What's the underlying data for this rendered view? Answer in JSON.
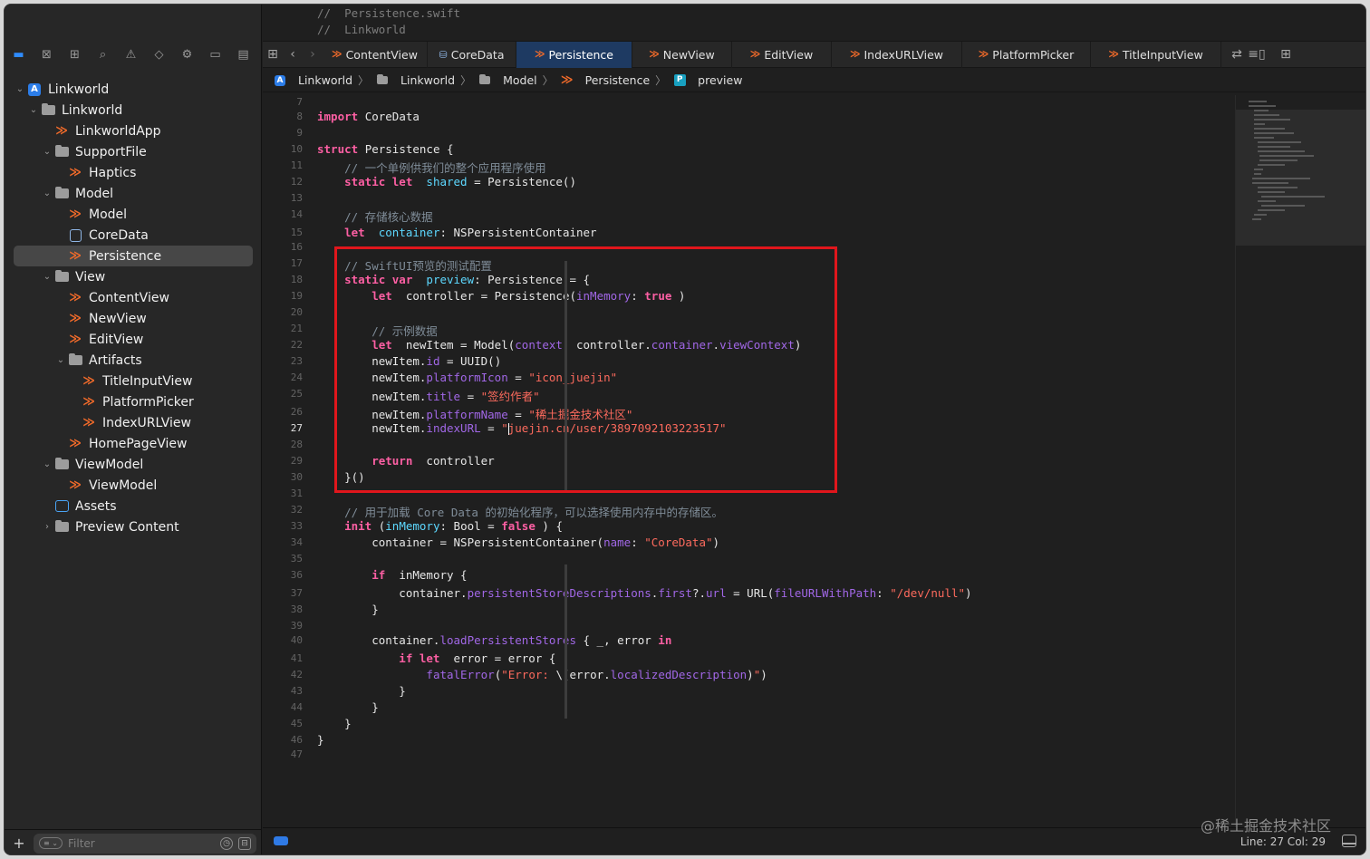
{
  "header_comment": [
    "//  Persistence.swift",
    "//  Linkworld"
  ],
  "navigator_icons": [
    "folder-icon",
    "source-control-icon",
    "symbols-icon",
    "find-icon",
    "issues-icon",
    "tests-icon",
    "debug-icon",
    "breakpoints-icon",
    "reports-icon"
  ],
  "tree": [
    {
      "label": "Linkworld",
      "depth": 0,
      "icon": "project",
      "disclosure": "open"
    },
    {
      "label": "Linkworld",
      "depth": 1,
      "icon": "folder",
      "disclosure": "open"
    },
    {
      "label": "LinkworldApp",
      "depth": 2,
      "icon": "swift",
      "disclosure": ""
    },
    {
      "label": "SupportFile",
      "depth": 2,
      "icon": "folder",
      "disclosure": "open"
    },
    {
      "label": "Haptics",
      "depth": 3,
      "icon": "swift",
      "disclosure": ""
    },
    {
      "label": "Model",
      "depth": 2,
      "icon": "folder",
      "disclosure": "open"
    },
    {
      "label": "Model",
      "depth": 3,
      "icon": "swift",
      "disclosure": ""
    },
    {
      "label": "CoreData",
      "depth": 3,
      "icon": "coredata",
      "disclosure": ""
    },
    {
      "label": "Persistence",
      "depth": 3,
      "icon": "swift",
      "disclosure": "",
      "selected": true
    },
    {
      "label": "View",
      "depth": 2,
      "icon": "folder",
      "disclosure": "open"
    },
    {
      "label": "ContentView",
      "depth": 3,
      "icon": "swift",
      "disclosure": ""
    },
    {
      "label": "NewView",
      "depth": 3,
      "icon": "swift",
      "disclosure": ""
    },
    {
      "label": "EditView",
      "depth": 3,
      "icon": "swift",
      "disclosure": ""
    },
    {
      "label": "Artifacts",
      "depth": 3,
      "icon": "folder",
      "disclosure": "open"
    },
    {
      "label": "TitleInputView",
      "depth": 4,
      "icon": "swift",
      "disclosure": ""
    },
    {
      "label": "PlatformPicker",
      "depth": 4,
      "icon": "swift",
      "disclosure": ""
    },
    {
      "label": "IndexURLView",
      "depth": 4,
      "icon": "swift",
      "disclosure": ""
    },
    {
      "label": "HomePageView",
      "depth": 3,
      "icon": "swift",
      "disclosure": ""
    },
    {
      "label": "ViewModel",
      "depth": 2,
      "icon": "folder",
      "disclosure": "open"
    },
    {
      "label": "ViewModel",
      "depth": 3,
      "icon": "swift",
      "disclosure": ""
    },
    {
      "label": "Assets",
      "depth": 2,
      "icon": "assets",
      "disclosure": ""
    },
    {
      "label": "Preview Content",
      "depth": 2,
      "icon": "folder",
      "disclosure": "closed"
    }
  ],
  "filter": {
    "placeholder": "Filter",
    "add_label": "+"
  },
  "tabs": [
    {
      "label": "ContentView",
      "icon": "swift",
      "active": false
    },
    {
      "label": "CoreData",
      "icon": "coredata",
      "active": false
    },
    {
      "label": "Persistence",
      "icon": "swift",
      "active": true
    },
    {
      "label": "NewView",
      "icon": "swift",
      "active": false
    },
    {
      "label": "EditView",
      "icon": "swift",
      "active": false
    },
    {
      "label": "IndexURLView",
      "icon": "swift",
      "active": false
    },
    {
      "label": "PlatformPicker",
      "icon": "swift",
      "active": false
    },
    {
      "label": "TitleInputView",
      "icon": "swift",
      "active": false
    }
  ],
  "breadcrumb": [
    {
      "label": "Linkworld",
      "icon": "project"
    },
    {
      "label": "Linkworld",
      "icon": "folder"
    },
    {
      "label": "Model",
      "icon": "folder"
    },
    {
      "label": "Persistence",
      "icon": "swift"
    },
    {
      "label": "preview",
      "icon": "property"
    }
  ],
  "code_lines": [
    {
      "n": "7",
      "segs": []
    },
    {
      "n": "8",
      "segs": [
        [
          "k",
          "import"
        ],
        [
          "",
          "CoreData"
        ]
      ]
    },
    {
      "n": "9",
      "segs": []
    },
    {
      "n": "10",
      "segs": [
        [
          "k",
          "struct"
        ],
        [
          "",
          "Persistence {"
        ]
      ]
    },
    {
      "n": "11",
      "segs": [
        [
          "c",
          "    // 一个单例供我们的整个应用程序使用"
        ]
      ]
    },
    {
      "n": "12",
      "segs": [
        [
          "k",
          "    static let"
        ],
        [
          "t",
          "shared"
        ],
        [
          "",
          " = Persistence()"
        ]
      ]
    },
    {
      "n": "13",
      "segs": []
    },
    {
      "n": "14",
      "segs": [
        [
          "c",
          "    // 存储核心数据"
        ]
      ]
    },
    {
      "n": "15",
      "segs": [
        [
          "k",
          "    let"
        ],
        [
          "t",
          "container"
        ],
        [
          "",
          ": NSPersistentContainer"
        ]
      ]
    },
    {
      "n": "16",
      "segs": []
    },
    {
      "n": "17",
      "segs": [
        [
          "c",
          "    // SwiftUI预览的测试配置"
        ]
      ]
    },
    {
      "n": "18",
      "segs": [
        [
          "k",
          "    static var"
        ],
        [
          "t",
          "preview"
        ],
        [
          "",
          ": Persistence = {"
        ]
      ]
    },
    {
      "n": "19",
      "segs": [
        [
          "k",
          "        let"
        ],
        [
          "",
          " controller = Persistence("
        ],
        [
          "p",
          "inMemory"
        ],
        [
          "",
          ": "
        ],
        [
          "k",
          "true"
        ],
        [
          "",
          ")"
        ]
      ]
    },
    {
      "n": "20",
      "segs": []
    },
    {
      "n": "21",
      "segs": [
        [
          "c",
          "        // 示例数据"
        ]
      ]
    },
    {
      "n": "22",
      "segs": [
        [
          "k",
          "        let"
        ],
        [
          "",
          " newItem = Model("
        ],
        [
          "p",
          "context"
        ],
        [
          "",
          ": controller."
        ],
        [
          "p",
          "container"
        ],
        [
          "",
          "."
        ],
        [
          "p",
          "viewContext"
        ],
        [
          "",
          ")"
        ]
      ]
    },
    {
      "n": "23",
      "segs": [
        [
          "",
          "        newItem."
        ],
        [
          "p",
          "id"
        ],
        [
          "",
          " = UUID()"
        ]
      ]
    },
    {
      "n": "24",
      "segs": [
        [
          "",
          "        newItem."
        ],
        [
          "p",
          "platformIcon"
        ],
        [
          "",
          " = "
        ],
        [
          "s",
          "\"icon_juejin\""
        ]
      ]
    },
    {
      "n": "25",
      "segs": [
        [
          "",
          "        newItem."
        ],
        [
          "p",
          "title"
        ],
        [
          "",
          " = "
        ],
        [
          "s",
          "\"签约作者\""
        ]
      ]
    },
    {
      "n": "26",
      "segs": [
        [
          "",
          "        newItem."
        ],
        [
          "p",
          "platformName"
        ],
        [
          "",
          " = "
        ],
        [
          "s",
          "\"稀土掘金技术社区\""
        ]
      ]
    },
    {
      "n": "27",
      "segs": [
        [
          "",
          "        newItem."
        ],
        [
          "p",
          "indexURL"
        ],
        [
          "",
          " = "
        ],
        [
          "s",
          "\""
        ],
        [
          "cursor",
          ""
        ],
        [
          "s",
          "juejin.cn/user/3897092103223517\""
        ]
      ]
    },
    {
      "n": "28",
      "segs": []
    },
    {
      "n": "29",
      "segs": [
        [
          "k",
          "        return"
        ],
        [
          "",
          " controller"
        ]
      ]
    },
    {
      "n": "30",
      "segs": [
        [
          "",
          "    }()"
        ]
      ]
    },
    {
      "n": "31",
      "segs": []
    },
    {
      "n": "32",
      "segs": [
        [
          "c",
          "    // 用于加载 Core Data 的初始化程序，可以选择使用内存中的存储区。"
        ]
      ]
    },
    {
      "n": "33",
      "segs": [
        [
          "k",
          "    init"
        ],
        [
          "",
          "("
        ],
        [
          "t",
          "inMemory"
        ],
        [
          "",
          ": Bool = "
        ],
        [
          "k",
          "false"
        ],
        [
          "",
          ") {"
        ]
      ]
    },
    {
      "n": "34",
      "segs": [
        [
          "",
          "        container = NSPersistentContainer("
        ],
        [
          "p",
          "name"
        ],
        [
          "",
          ": "
        ],
        [
          "s",
          "\"CoreData\""
        ],
        [
          "",
          ")"
        ]
      ]
    },
    {
      "n": "35",
      "segs": []
    },
    {
      "n": "36",
      "segs": [
        [
          "k",
          "        if"
        ],
        [
          "",
          " inMemory {"
        ]
      ]
    },
    {
      "n": "37",
      "segs": [
        [
          "",
          "            container."
        ],
        [
          "p",
          "persistentStoreDescriptions"
        ],
        [
          "",
          "."
        ],
        [
          "p",
          "first"
        ],
        [
          "",
          "?."
        ],
        [
          "p",
          "url"
        ],
        [
          "",
          " = URL("
        ],
        [
          "p",
          "fileURLWithPath"
        ],
        [
          "",
          ": "
        ],
        [
          "s",
          "\"/dev/null\""
        ],
        [
          "",
          ")"
        ]
      ]
    },
    {
      "n": "38",
      "segs": [
        [
          "",
          "        }"
        ]
      ]
    },
    {
      "n": "39",
      "segs": []
    },
    {
      "n": "40",
      "segs": [
        [
          "",
          "        container."
        ],
        [
          "p",
          "loadPersistentStores"
        ],
        [
          "",
          " { _, error "
        ],
        [
          "k",
          "in"
        ]
      ]
    },
    {
      "n": "41",
      "segs": [
        [
          "k",
          "            if let"
        ],
        [
          "",
          " error = error {"
        ]
      ]
    },
    {
      "n": "42",
      "segs": [
        [
          "",
          "                "
        ],
        [
          "p",
          "fatalError"
        ],
        [
          "",
          "("
        ],
        [
          "s",
          "\"Error: "
        ],
        [
          "",
          "\\(error."
        ],
        [
          "p",
          "localizedDescription"
        ],
        [
          "",
          ")"
        ],
        [
          "s",
          "\""
        ],
        [
          "",
          ")"
        ]
      ]
    },
    {
      "n": "43",
      "segs": [
        [
          "",
          "            }"
        ]
      ]
    },
    {
      "n": "44",
      "segs": [
        [
          "",
          "        }"
        ]
      ]
    },
    {
      "n": "45",
      "segs": [
        [
          "",
          "    }"
        ]
      ]
    },
    {
      "n": "46",
      "segs": [
        [
          "",
          "}"
        ]
      ]
    },
    {
      "n": "47",
      "segs": []
    }
  ],
  "current_line": "27",
  "status": {
    "line_col": "Line: 27  Col: 29",
    "watermark": "@稀土掘金技术社区"
  }
}
